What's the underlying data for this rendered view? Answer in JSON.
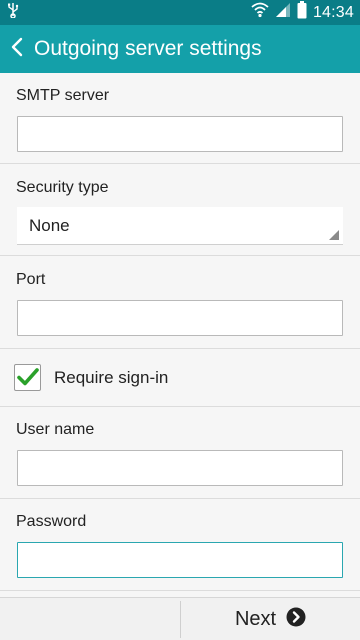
{
  "status_bar": {
    "time": "14:34",
    "icons": [
      "usb-icon",
      "wifi-icon",
      "signal-icon",
      "battery-icon"
    ]
  },
  "app_bar": {
    "title": "Outgoing server settings",
    "back_icon": "chevron-left-icon"
  },
  "form": {
    "smtp_server": {
      "label": "SMTP server",
      "value": ""
    },
    "security_type": {
      "label": "Security type",
      "selected": "None"
    },
    "port": {
      "label": "Port",
      "value": ""
    },
    "require_sign_in": {
      "label": "Require sign-in",
      "checked": true
    },
    "user_name": {
      "label": "User name",
      "value": ""
    },
    "password": {
      "label": "Password",
      "value": ""
    }
  },
  "footer": {
    "next_label": "Next",
    "next_icon": "arrow-circle-right-icon"
  },
  "colors": {
    "status_bar": "#0a7d87",
    "app_bar": "#14a0a9",
    "checkmark": "#2aa12a",
    "focus": "#2aa7b0"
  }
}
